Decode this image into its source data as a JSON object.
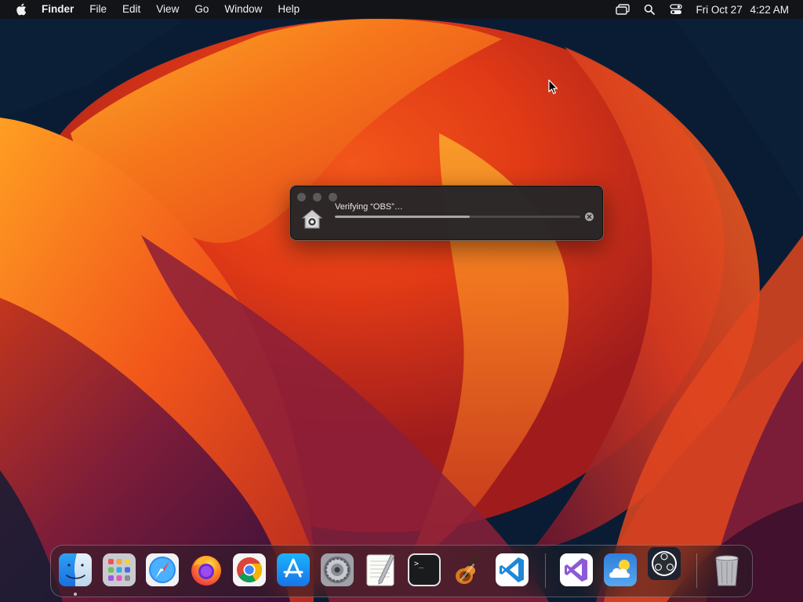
{
  "menubar": {
    "app_name": "Finder",
    "items": [
      "File",
      "Edit",
      "View",
      "Go",
      "Window",
      "Help"
    ],
    "clock": {
      "date": "Fri Oct 27",
      "time": "4:22 AM"
    },
    "status_icons": [
      "screen-mirroring-icon",
      "spotlight-search-icon",
      "control-center-icon"
    ]
  },
  "verify_dialog": {
    "title": "Verifying “OBS”…",
    "progress_percent": 55
  },
  "dock": {
    "apps": [
      {
        "name": "Finder",
        "icon": "finder-icon",
        "running": true
      },
      {
        "name": "Launchpad",
        "icon": "launchpad-icon",
        "running": false
      },
      {
        "name": "Safari",
        "icon": "safari-icon",
        "running": false
      },
      {
        "name": "Firefox",
        "icon": "firefox-icon",
        "running": false
      },
      {
        "name": "Google Chrome",
        "icon": "chrome-icon",
        "running": false
      },
      {
        "name": "App Store",
        "icon": "app-store-icon",
        "running": false
      },
      {
        "name": "System Settings",
        "icon": "system-settings-icon",
        "running": false
      },
      {
        "name": "TextEdit",
        "icon": "textedit-icon",
        "running": false
      },
      {
        "name": "Terminal",
        "icon": "terminal-icon",
        "running": false
      },
      {
        "name": "GarageBand",
        "icon": "garageband-icon",
        "running": false
      },
      {
        "name": "Visual Studio Code",
        "icon": "vscode-icon",
        "running": false
      },
      {
        "name": "Visual Studio",
        "icon": "visual-studio-icon",
        "running": false
      },
      {
        "name": "Weather",
        "icon": "weather-icon",
        "running": false
      },
      {
        "name": "OBS",
        "icon": "obs-icon",
        "running": false
      },
      {
        "name": "Trash",
        "icon": "trash-icon",
        "running": false
      }
    ],
    "terminal_glyph": ">_"
  },
  "colors": {
    "menubar_bg": "#141416",
    "panel_bg": "#262628",
    "wallpaper_orange": "#f26b1d",
    "wallpaper_deep": "#0a1a33"
  }
}
